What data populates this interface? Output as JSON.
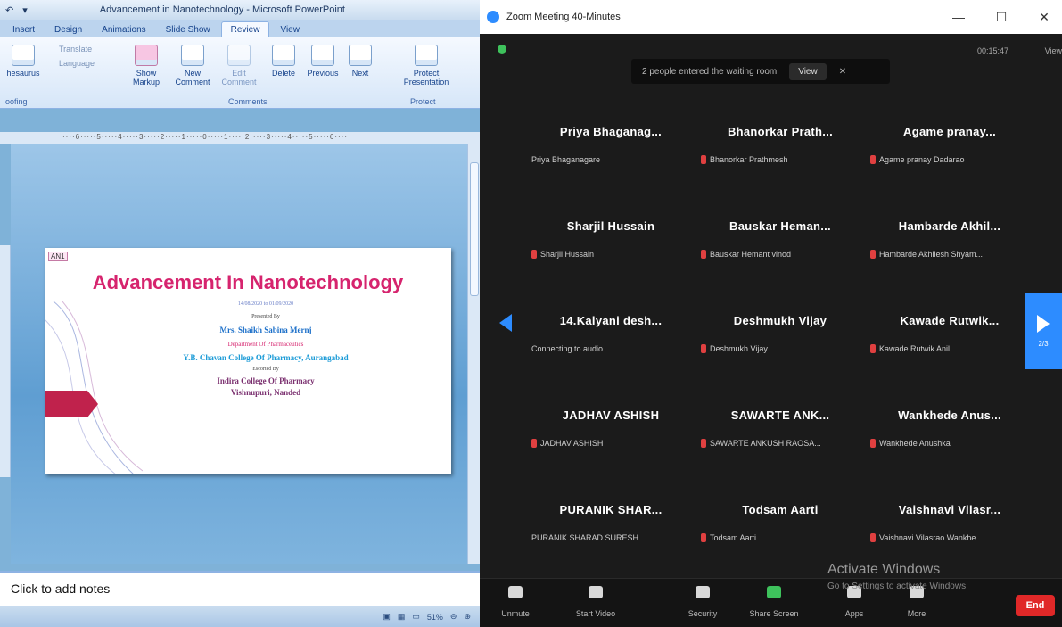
{
  "ppt": {
    "title": "Advancement in Nanotechnology - Microsoft PowerPoint",
    "tabs": [
      "Insert",
      "Design",
      "Animations",
      "Slide Show",
      "Review",
      "View"
    ],
    "active_tab": "Review",
    "ribbon": {
      "thesaurus": "hesaurus",
      "translate": "Translate",
      "language": "Language",
      "show_markup": "Show Markup",
      "new_comment": "New Comment",
      "edit_comment": "Edit Comment",
      "delete": "Delete",
      "previous": "Previous",
      "next": "Next",
      "protect": "Protect Presentation",
      "group_proofing": "oofing",
      "group_comments": "Comments",
      "group_protect": "Protect"
    },
    "ruler": "····6·····5·····4·····3·····2·····1·····0·····1·····2·····3·····4·····5·····6····",
    "slide": {
      "comment_tag": "AN1",
      "title": "Advancement In Nanotechnology",
      "dates": "14/08/2020 to 01/09/2020",
      "presented_by": "Presented By",
      "presenter": "Mrs. Shaikh Sabina Mernj",
      "department": "Department Of Pharmaceutics",
      "college1": "Y.B. Chavan College Of Pharmacy, Aurangabad",
      "escorted": "Escorted By",
      "college2": "Indira College Of Pharmacy",
      "location": "Vishnupuri, Nanded"
    },
    "notes_placeholder": "Click to add notes",
    "zoom_level": "51%"
  },
  "zoom": {
    "title": "Zoom Meeting 40-Minutes",
    "waiting_banner": "2 people entered the waiting room",
    "view_button": "View",
    "timer": "00:15:47",
    "view_label": "View",
    "page_indicator": "2/3",
    "watermark": "Activate Windows",
    "watermark_sub": "Go to Settings to activate Windows.",
    "participants": [
      {
        "display": "Priya Bhaganag...",
        "name": "Priya Bhaganagare",
        "muted": false
      },
      {
        "display": "Bhanorkar Prath...",
        "name": "Bhanorkar Prathmesh",
        "muted": true
      },
      {
        "display": "Agame pranay...",
        "name": "Agame pranay Dadarao",
        "muted": true
      },
      {
        "display": "Sharjil Hussain",
        "name": "Sharjil Hussain",
        "muted": true
      },
      {
        "display": "Bauskar Heman...",
        "name": "Bauskar Hemant vinod",
        "muted": true
      },
      {
        "display": "Hambarde Akhil...",
        "name": "Hambarde Akhilesh Shyam...",
        "muted": true
      },
      {
        "display": "14.Kalyani desh...",
        "name": "Connecting to audio ...",
        "muted": false
      },
      {
        "display": "Deshmukh Vijay",
        "name": "Deshmukh Vijay",
        "muted": true
      },
      {
        "display": "Kawade Rutwik...",
        "name": "Kawade Rutwik Anil",
        "muted": true
      },
      {
        "display": "JADHAV ASHISH",
        "name": "JADHAV ASHISH",
        "muted": true
      },
      {
        "display": "SAWARTE ANK...",
        "name": "SAWARTE ANKUSH RAOSA...",
        "muted": true
      },
      {
        "display": "Wankhede Anus...",
        "name": "Wankhede Anushka",
        "muted": true
      },
      {
        "display": "PURANIK SHAR...",
        "name": "PURANIK SHARAD SURESH",
        "muted": false
      },
      {
        "display": "Todsam Aarti",
        "name": "Todsam Aarti",
        "muted": true
      },
      {
        "display": "Vaishnavi Vilasr...",
        "name": "Vaishnavi Vilasrao Wankhe...",
        "muted": true
      }
    ],
    "toolbar": {
      "unmute": "Unmute",
      "start_video": "Start Video",
      "security": "Security",
      "share_screen": "Share Screen",
      "apps": "Apps",
      "more": "More",
      "end": "End"
    }
  }
}
